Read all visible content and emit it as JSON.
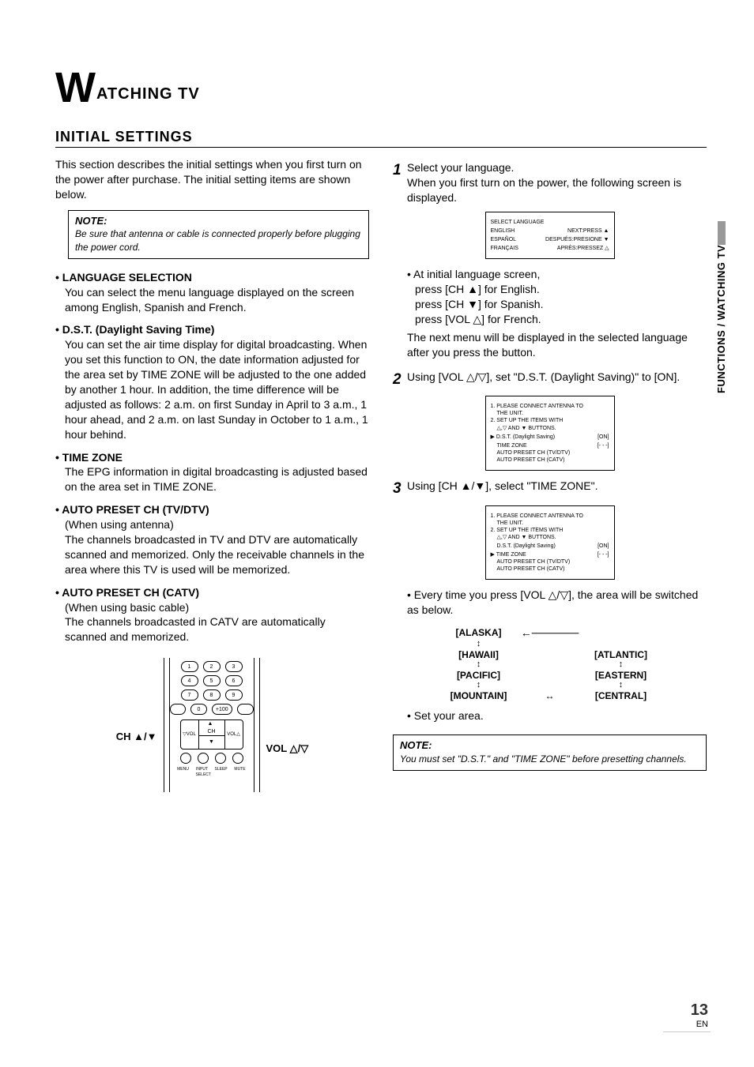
{
  "chapter": {
    "big": "W",
    "rest": "ATCHING TV"
  },
  "section_title": "INITIAL SETTINGS",
  "intro": "This section describes the initial settings when you first turn on the power after purchase. The initial setting items are shown below.",
  "note1": {
    "label": "NOTE:",
    "text": "Be sure that antenna or cable is connected properly before plugging the power cord."
  },
  "left": {
    "lang": {
      "title": "• LANGUAGE SELECTION",
      "text": "You can select the menu language displayed on the screen among English, Spanish and French."
    },
    "dst": {
      "title": "• D.S.T. (Daylight Saving Time)",
      "text": "You can set the air time display for digital broadcasting. When you set this function to ON, the date information adjusted for the area set by TIME ZONE will be adjusted to the one added by another 1 hour. In addition, the time difference will be adjusted as follows: 2 a.m. on first Sunday in April to 3 a.m., 1 hour ahead, and 2 a.m. on last Sunday in October to 1 a.m., 1 hour behind."
    },
    "tz": {
      "title": "• TIME ZONE",
      "text": "The EPG information in digital broadcasting is adjusted based on the area set in TIME ZONE."
    },
    "tvdtv": {
      "title": "• AUTO PRESET CH (TV/DTV)",
      "sub": "(When using antenna)",
      "text": "The channels broadcasted in TV and DTV are automatically scanned and memorized. Only the receivable channels in the area where this TV is used will be memorized."
    },
    "catv": {
      "title": "• AUTO PRESET CH (CATV)",
      "sub": "(When using basic cable)",
      "text": "The channels broadcasted in CATV are automatically scanned and memorized."
    },
    "remote_left": "CH ▲/▼",
    "remote_right": "VOL △/▽"
  },
  "right": {
    "step1": {
      "num": "1",
      "line1": "Select your language.",
      "line2": "When you first turn on the power, the following screen is displayed."
    },
    "screen1": {
      "title": "SELECT LANGUAGE",
      "r1a": "ENGLISH",
      "r1b": "NEXT:PRESS ▲",
      "r2a": "ESPAÑOL",
      "r2b": "DESPUÉS:PRESIONE ▼",
      "r3a": "FRANÇAIS",
      "r3b": "APRÈS:PRESSEZ △"
    },
    "lang_instr": {
      "l0": "• At initial language screen,",
      "l1": "press [CH ▲] for English.",
      "l2": "press [CH ▼] for Spanish.",
      "l3": "press [VOL △] for French.",
      "l4": "The next menu will be displayed in the selected language after you press the button."
    },
    "step2": {
      "num": "2",
      "text": "Using [VOL △/▽], set \"D.S.T. (Daylight Saving)\" to [ON]."
    },
    "screen2": {
      "l1": "1. PLEASE CONNECT ANTENNA TO",
      "l1b": "THE UNIT.",
      "l2": "2. SET UP THE ITEMS WITH",
      "l2b": "△,▽ AND ▼ BUTTONS.",
      "r1a": "▶ D.S.T. (Daylight Saving)",
      "r1b": "[ON]",
      "r2a": "TIME ZONE",
      "r2b": "[- - -]",
      "r3": "AUTO PRESET CH (TV/DTV)",
      "r4": "AUTO PRESET CH (CATV)"
    },
    "step3": {
      "num": "3",
      "text": "Using [CH ▲/▼], select \"TIME ZONE\"."
    },
    "screen3": {
      "l1": "1. PLEASE CONNECT ANTENNA TO",
      "l1b": "THE UNIT.",
      "l2": "2. SET UP THE ITEMS WITH",
      "l2b": "△,▽ AND ▼ BUTTONS.",
      "r1a": "D.S.T. (Daylight Saving)",
      "r1b": "[ON]",
      "r2a": "▶ TIME ZONE",
      "r2b": "[- - -]",
      "r3": "AUTO PRESET CH (TV/DTV)",
      "r4": "AUTO PRESET CH (CATV)"
    },
    "every": "• Every time you press [VOL △/▽], the area will be switched as below.",
    "cycle": {
      "alaska": "[ALASKA]",
      "hawaii": "[HAWAII]",
      "pacific": "[PACIFIC]",
      "mountain": "[MOUNTAIN]",
      "central": "[CENTRAL]",
      "eastern": "[EASTERN]",
      "atlantic": "[ATLANTIC]"
    },
    "set_area": "• Set your area.",
    "note2": {
      "label": "NOTE:",
      "text": "You must set \"D.S.T.\" and \"TIME ZONE\" before presetting channels."
    }
  },
  "sidetab": "FUNCTIONS / WATCHING TV",
  "pagenum": {
    "num": "13",
    "lang": "EN"
  }
}
